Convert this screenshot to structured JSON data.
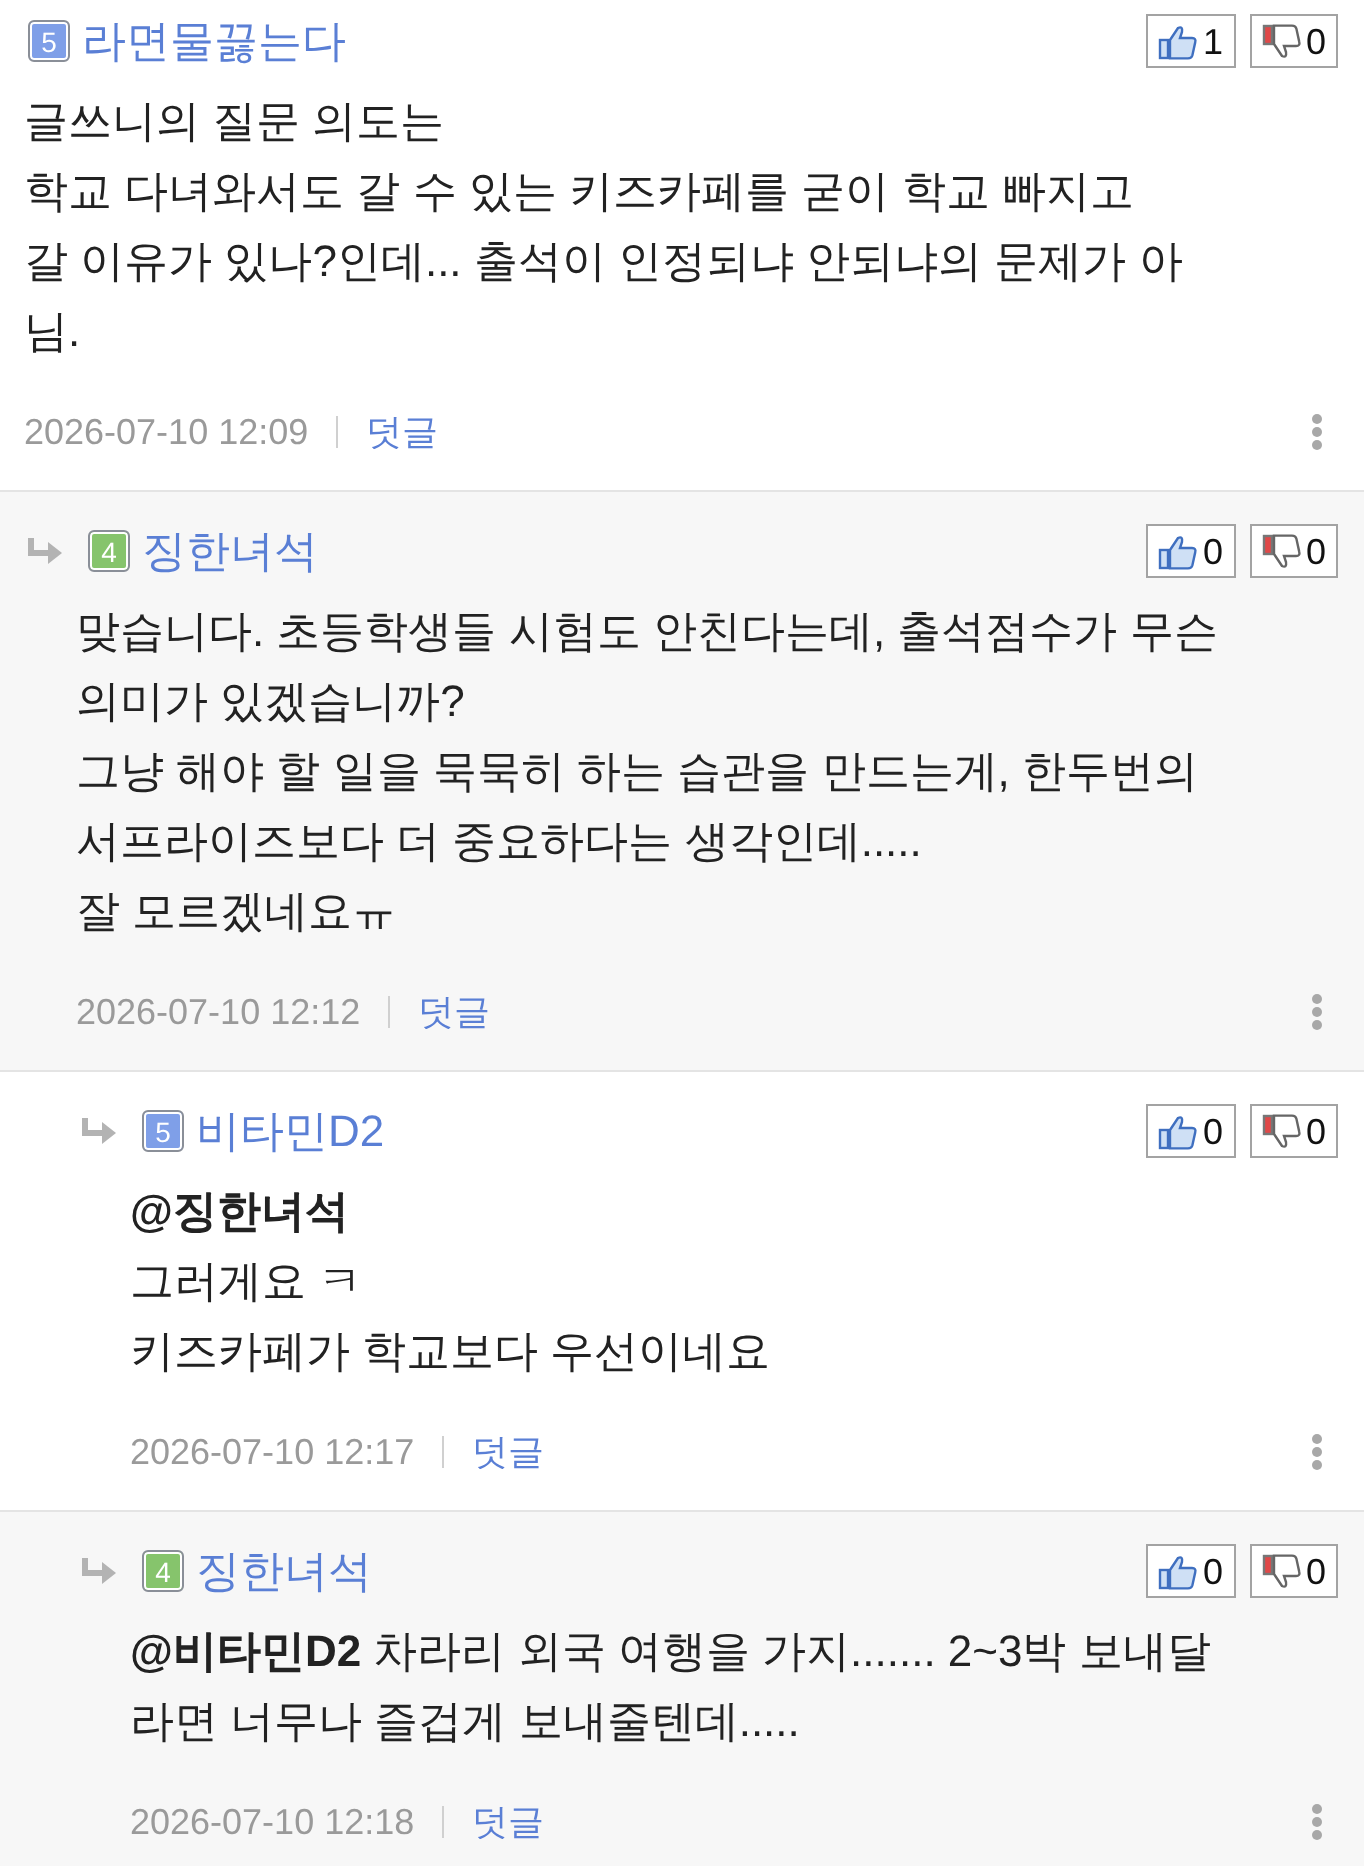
{
  "comments": [
    {
      "author": {
        "level": "5",
        "color": "#7f9fe8",
        "name": "라면물끓는다"
      },
      "likes": "1",
      "dislikes": "0",
      "body": [
        "글쓰니의 질문 의도는",
        "학교 다녀와서도 갈 수 있는 키즈카페를 굳이 학교 빠지고",
        "갈 이유가 있나?인데... 출석이 인정되냐 안되냐의 문제가 아",
        "님."
      ],
      "date": "2026-07-10 12:09",
      "reply_label": "덧글",
      "children": [
        {
          "author": {
            "level": "4",
            "color": "#86c46c",
            "name": "징한녀석"
          },
          "likes": "0",
          "dislikes": "0",
          "body": [
            "맞습니다. 초등학생들 시험도 안친다는데, 출석점수가 무슨",
            "의미가 있겠습니까?",
            "그냥 해야 할 일을 묵묵히 하는 습관을 만드는게, 한두번의",
            "서프라이즈보다 더 중요하다는 생각인데.....",
            "잘 모르겠네요ㅠ"
          ],
          "date": "2026-07-10 12:12",
          "reply_label": "덧글",
          "children": [
            {
              "author": {
                "level": "5",
                "color": "#7f9fe8",
                "name": "비타민D2"
              },
              "likes": "0",
              "dislikes": "0",
              "body": [
                "**@징한녀석**",
                "그러게요 ㅋ",
                "키즈카페가 학교보다 우선이네요"
              ],
              "date": "2026-07-10 12:17",
              "reply_label": "덧글"
            },
            {
              "author": {
                "level": "4",
                "color": "#86c46c",
                "name": "징한녀석"
              },
              "likes": "0",
              "dislikes": "0",
              "body": [
                "**@비타민D2** 차라리 외국 여행을 가지....... 2~3박 보내달",
                "라면 너무나 즐겁게 보내줄텐데....."
              ],
              "date": "2026-07-10 12:18",
              "reply_label": "덧글"
            }
          ]
        }
      ]
    }
  ]
}
